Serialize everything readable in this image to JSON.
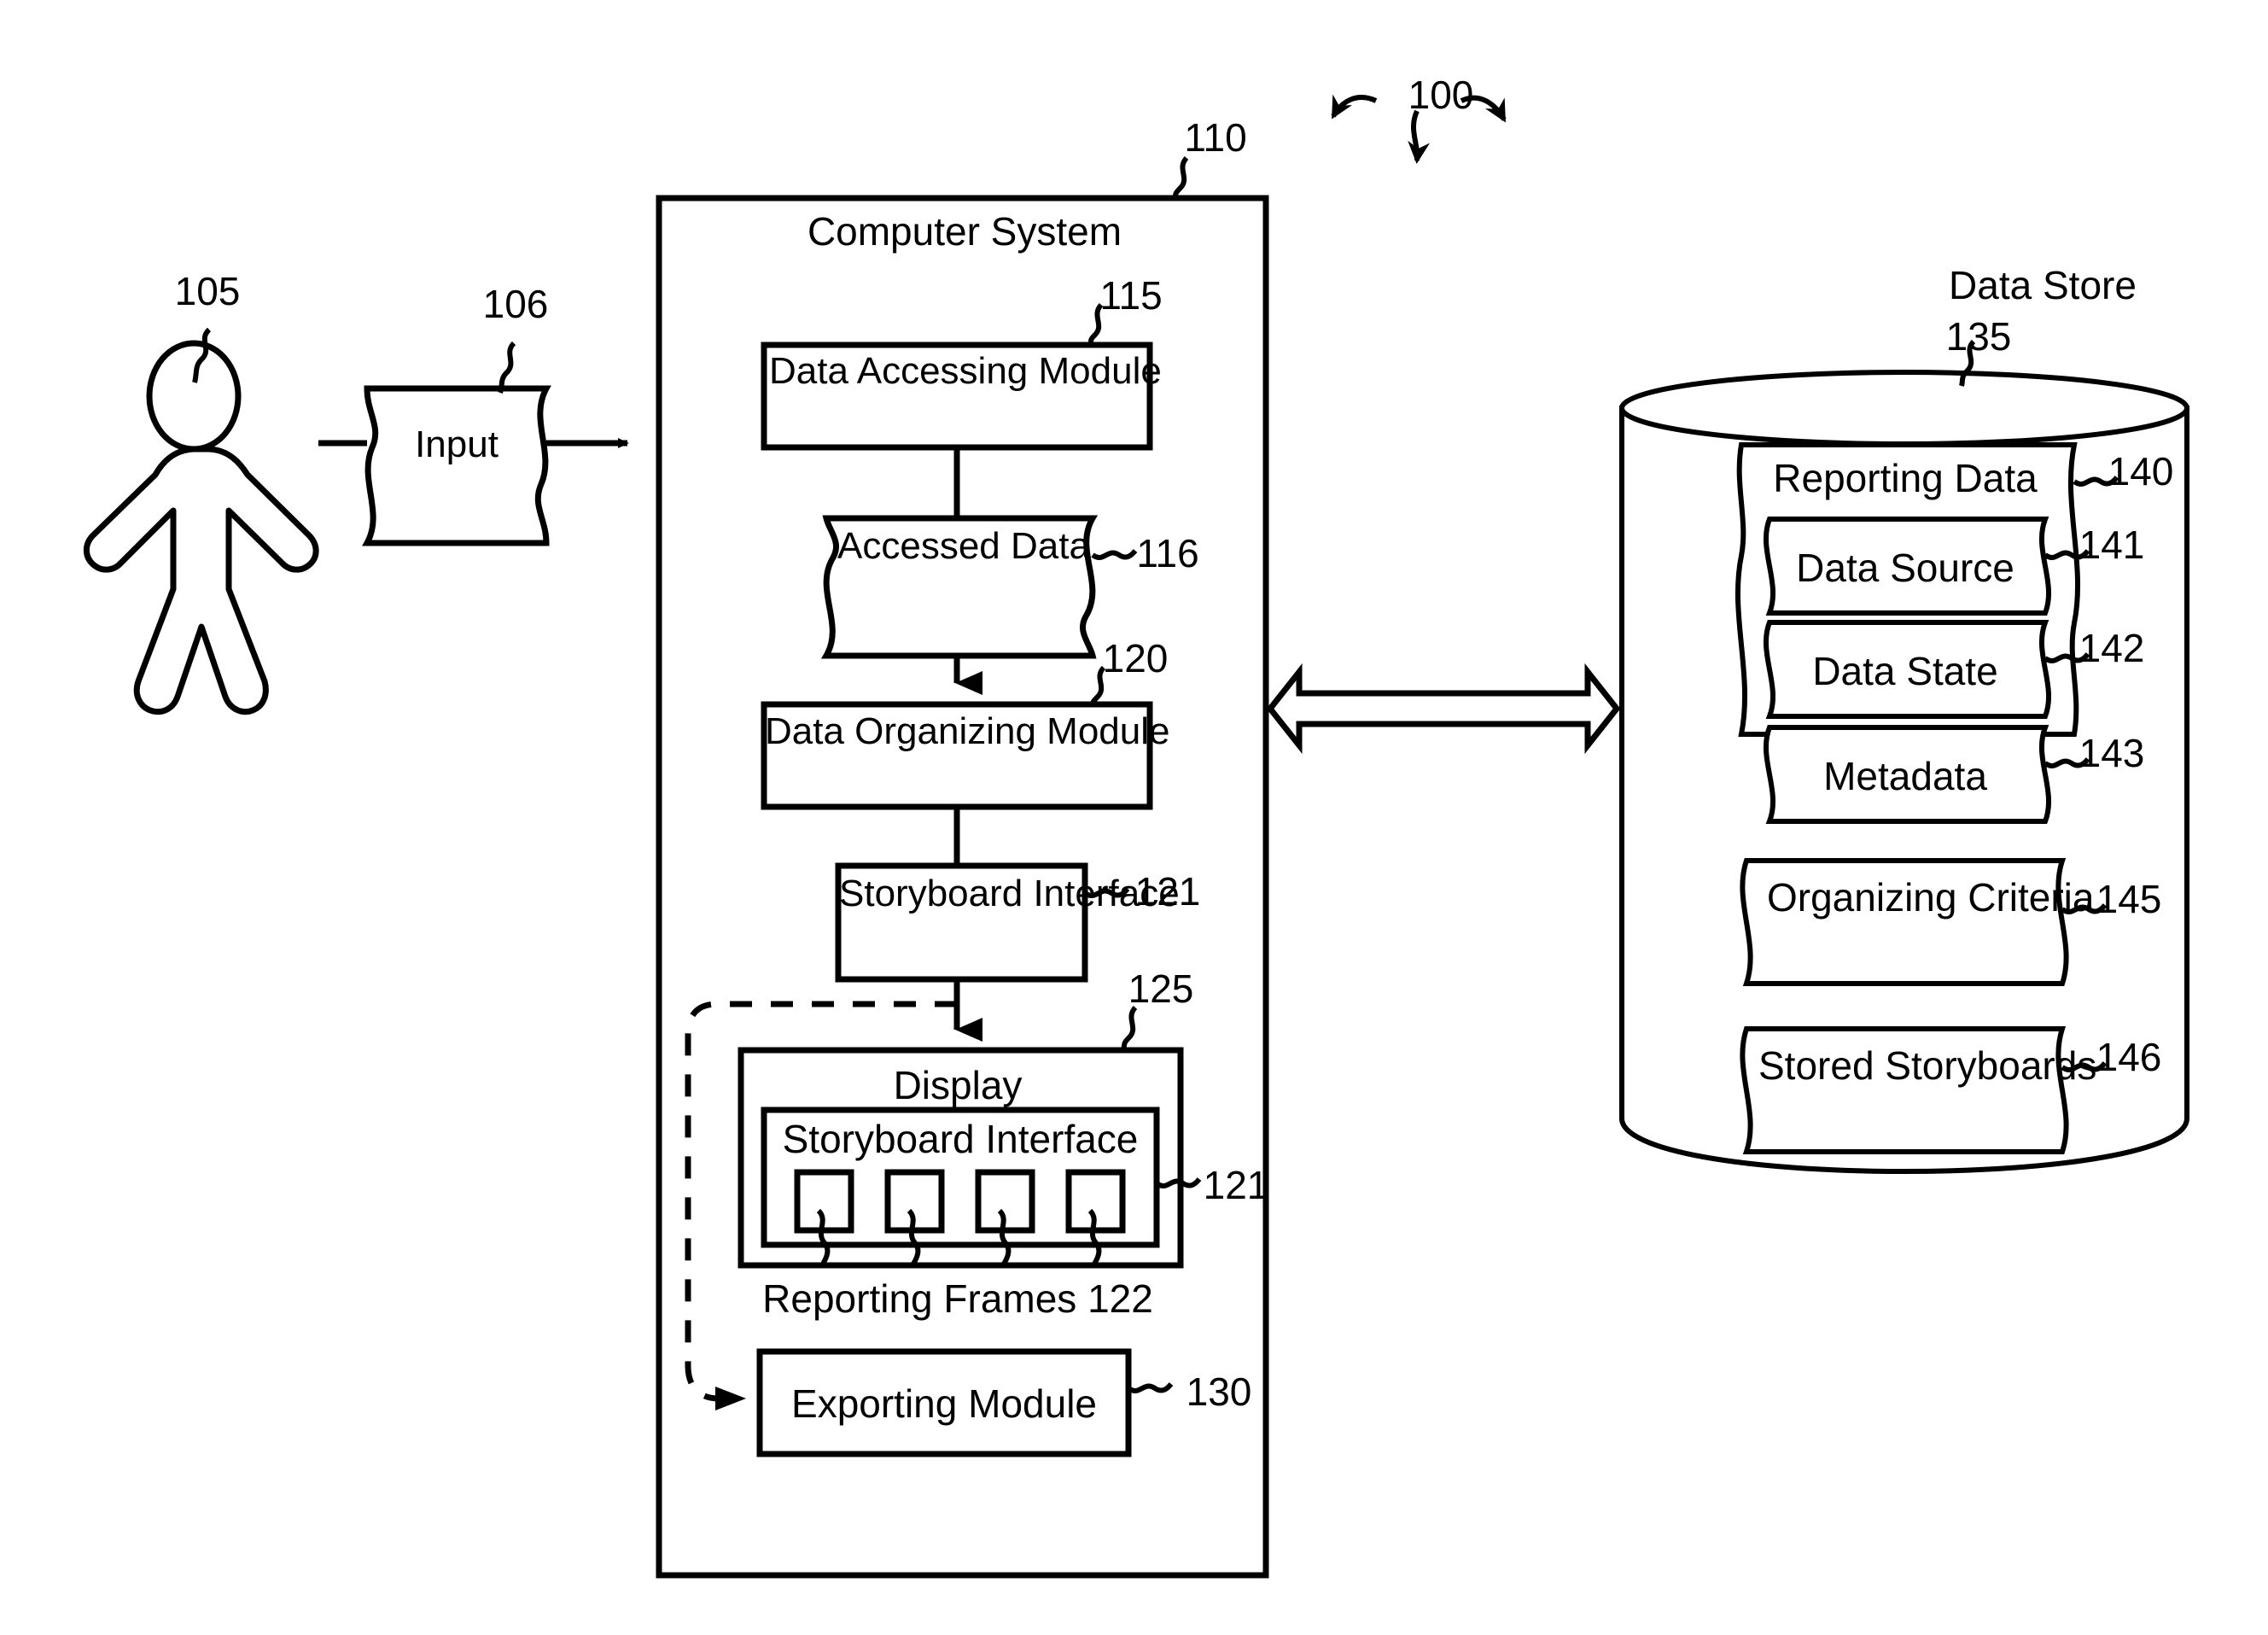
{
  "figure": {
    "title_ref": "100",
    "domain": "patent-system-diagram"
  },
  "actor": {
    "name": "user-stick-figure",
    "ref": "105"
  },
  "input": {
    "label": "Input",
    "ref": "106"
  },
  "computer_system": {
    "label": "Computer System",
    "ref": "110",
    "modules": [
      {
        "label": "Data Accessing Module",
        "ref": "115",
        "shape": "rect"
      },
      {
        "label": "Accessed Data",
        "ref": "116",
        "shape": "wavy"
      },
      {
        "label": "Data Organizing Module",
        "ref": "120",
        "shape": "rect"
      },
      {
        "label": "Storyboard Interface",
        "ref": "121",
        "shape": "rect"
      },
      {
        "label": "Display",
        "ref": "125",
        "shape": "rect"
      },
      {
        "label": "Exporting Module",
        "ref": "130",
        "shape": "rect"
      }
    ],
    "display": {
      "label": "Display",
      "ref": "125",
      "storyboard_interface": {
        "label": "Storyboard Interface",
        "ref": "121",
        "frames_label": "Reporting Frames 122",
        "frames_count": 4,
        "frames": [
          {
            "name": "reporting-frame-1"
          },
          {
            "name": "reporting-frame-2"
          },
          {
            "name": "reporting-frame-3"
          },
          {
            "name": "reporting-frame-4"
          }
        ]
      }
    }
  },
  "data_store": {
    "label": "Data Store",
    "ref": "135",
    "reporting_data": {
      "label": "Reporting Data",
      "ref": "140",
      "items": [
        {
          "label": "Data Source",
          "ref": "141"
        },
        {
          "label": "Data State",
          "ref": "142"
        },
        {
          "label": "Metadata",
          "ref": "143"
        }
      ]
    },
    "other_items": [
      {
        "label": "Organizing Criteria",
        "ref": "145"
      },
      {
        "label": "Stored Storyboards",
        "ref": "146"
      }
    ]
  },
  "connectors": {
    "bidirectional_arrow": "computer-system <-> data-store",
    "feedback_dashed": "storyboard-interface -> exporting-module"
  },
  "colors": {
    "stroke": "#000000",
    "background": "#ffffff"
  }
}
